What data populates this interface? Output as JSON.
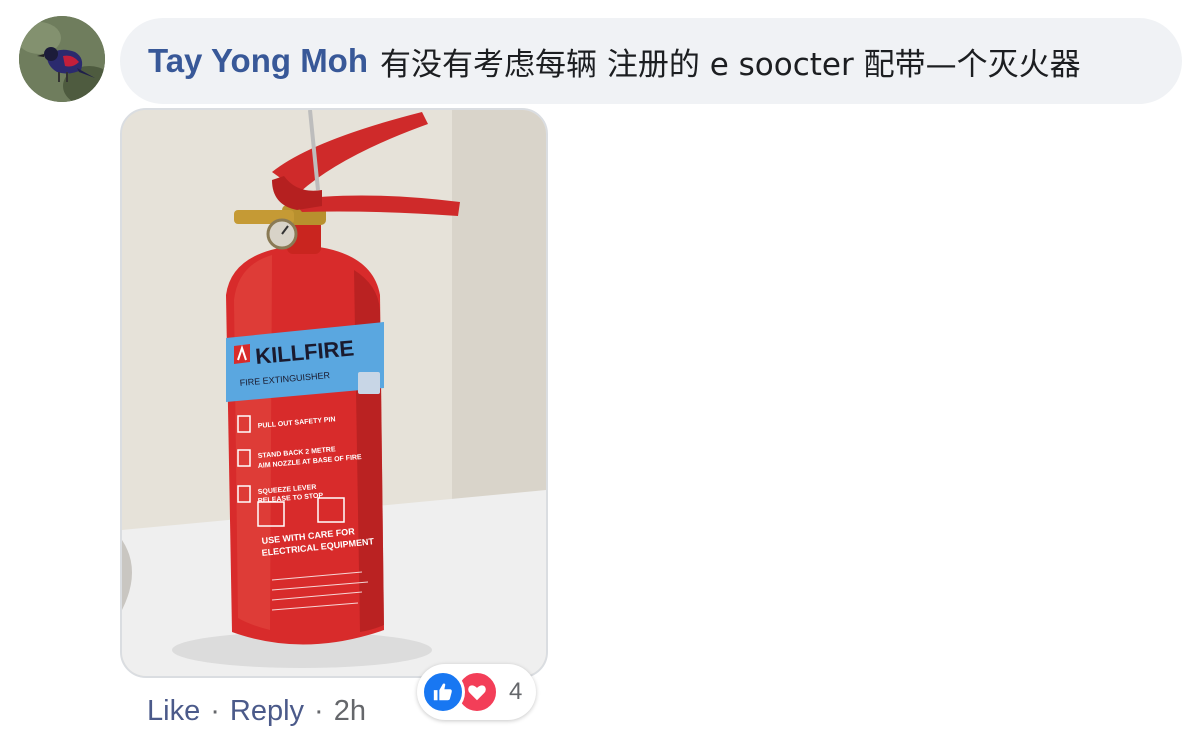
{
  "comment": {
    "author": "Tay Yong Moh",
    "text": "有没有考虑每辆 注册的 e soocter 配带—个灭火器"
  },
  "photo": {
    "brand": "KILLFIRE",
    "product": "FIRE EXTINGUISHER",
    "instruction_1": "PULL OUT SAFETY PIN",
    "instruction_2": "STAND BACK 2 METRE",
    "instruction_3": "AIM NOZZLE AT BASE OF FIRE",
    "instruction_4": "SQUEEZE LEVER",
    "instruction_5": "RELEASE TO STOP",
    "warning_1": "USE WITH CARE FOR",
    "warning_2": "ELECTRICAL EQUIPMENT"
  },
  "actions": {
    "like": "Like",
    "separator": "·",
    "reply": "Reply",
    "time": "2h"
  },
  "reactions": {
    "count": "4",
    "icons": [
      "like-icon",
      "love-icon"
    ],
    "like_color": "#1877f2",
    "love_color": "#f33e58"
  },
  "colors": {
    "author": "#385898",
    "bubble": "#f0f2f5",
    "meta_text": "#65676b"
  }
}
